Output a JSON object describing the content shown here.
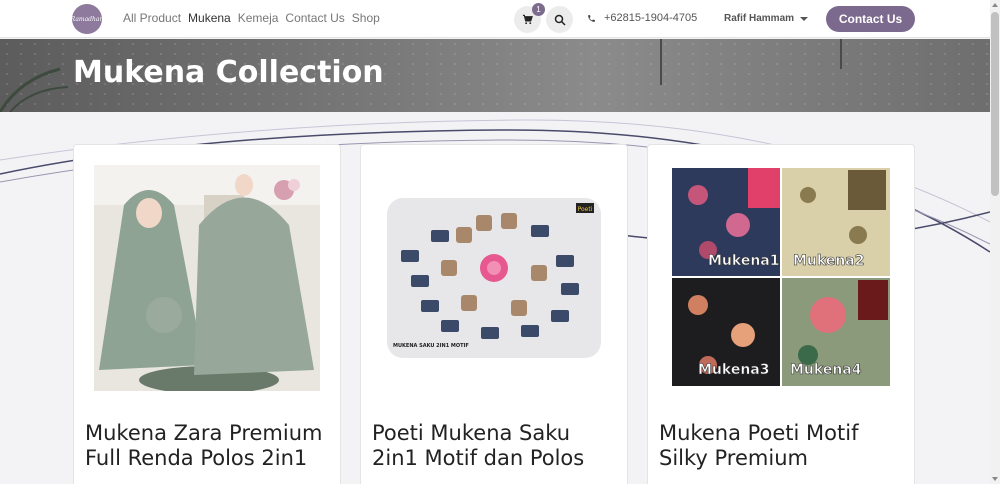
{
  "navbar": {
    "logo_text": "Ramadhan",
    "links": [
      "All Product",
      "Mukena",
      "Kemeja",
      "Contact Us",
      "Shop"
    ],
    "active_link": "Mukena",
    "cart_count": "1",
    "phone": "+62815-1904-4705",
    "user_name": "Rafif Hammam",
    "contact_button": "Contact Us"
  },
  "hero": {
    "title": "Mukena Collection"
  },
  "products": [
    {
      "title": "Mukena Zara Premium Full Renda Polos 2in1"
    },
    {
      "title": "Poeti Mukena Saku 2in1 Motif dan Polos",
      "image_caption_top": "Poeti",
      "image_caption": "MUKENA SAKU 2IN1 MOTIF"
    },
    {
      "title": "Mukena Poeti Motif Silky Premium",
      "image_labels": [
        "Mukena1",
        "Mukena2",
        "Mukena3",
        "Mukena4"
      ]
    }
  ],
  "colors": {
    "brand": "#7b6a8d",
    "hero_bg": "#6e6e6e",
    "page_bg": "#f3f3f5"
  },
  "icons": [
    "cart-icon",
    "search-icon",
    "phone-icon",
    "caret-down-icon"
  ]
}
